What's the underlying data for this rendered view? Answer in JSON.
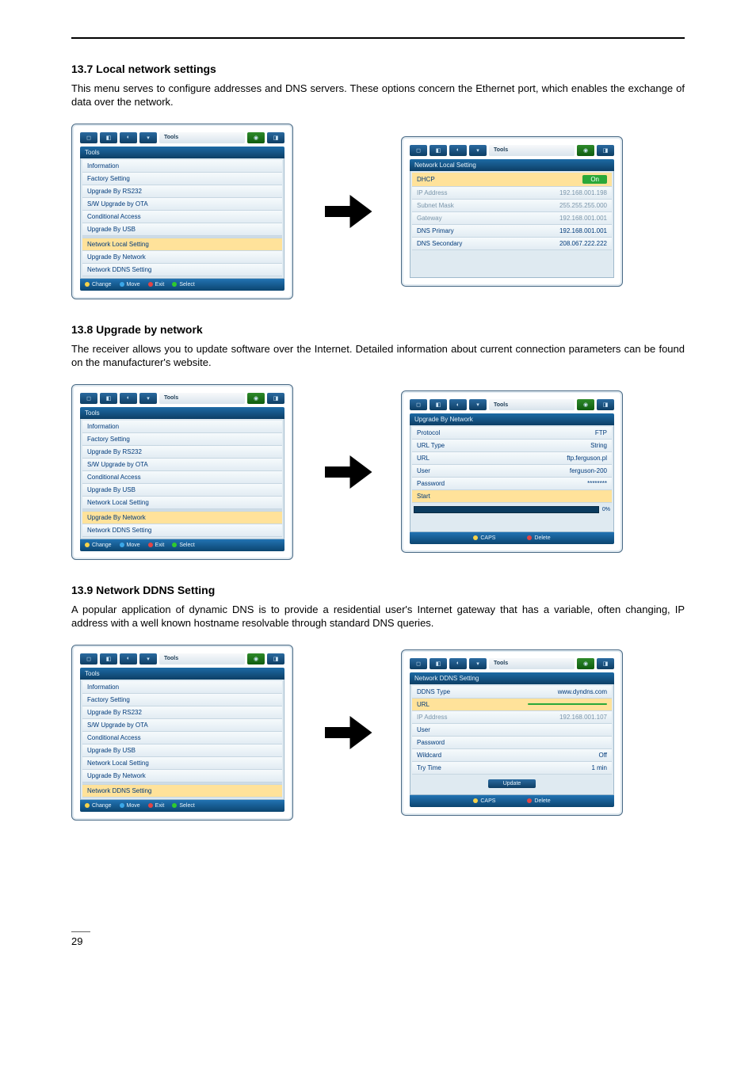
{
  "page_number": "29",
  "sections": {
    "s137": {
      "heading": "13.7 Local network settings",
      "body": "This menu serves to configure addresses and DNS servers. These options concern the Ethernet port, which enables the exchange of data over the network."
    },
    "s138": {
      "heading": "13.8 Upgrade by network",
      "body": "The receiver allows you to update software over the Internet. Detailed information about current connection parameters can be found on the manufacturer's website."
    },
    "s139": {
      "heading": "13.9 Network DDNS Setting",
      "body": "A popular application of dynamic DNS is to provide a residential user's Internet gateway that has a variable, often changing, IP address with a well known hostname resolvable through standard DNS queries."
    }
  },
  "tools_menu": {
    "tab_label": "Tools",
    "title": "Tools",
    "items": [
      "Information",
      "Factory Setting",
      "Upgrade By RS232",
      "S/W Upgrade by OTA",
      "Conditional Access",
      "Upgrade By USB",
      "Network Local Setting",
      "Upgrade By Network",
      "Network DDNS Setting"
    ],
    "footer": {
      "change": "Change",
      "move": "Move",
      "exit": "Exit",
      "select": "Select"
    }
  },
  "network_local": {
    "title": "Network Local Setting",
    "rows": {
      "dhcp": {
        "label": "DHCP",
        "value": "On"
      },
      "ip": {
        "label": "IP Address",
        "value": "192.168.001.198"
      },
      "mask": {
        "label": "Subnet Mask",
        "value": "255.255.255.000"
      },
      "gw": {
        "label": "Gateway",
        "value": "192.168.001.001"
      },
      "dns1": {
        "label": "DNS Primary",
        "value": "192.168.001.001"
      },
      "dns2": {
        "label": "DNS Secondary",
        "value": "208.067.222.222"
      }
    }
  },
  "upgrade_network": {
    "title": "Upgrade By Network",
    "rows": {
      "protocol": {
        "label": "Protocol",
        "value": "FTP"
      },
      "urltype": {
        "label": "URL Type",
        "value": "String"
      },
      "url": {
        "label": "URL",
        "value": "ftp.ferguson.pl"
      },
      "user": {
        "label": "User",
        "value": "ferguson-200"
      },
      "pass": {
        "label": "Password",
        "value": "********"
      },
      "start": {
        "label": "Start",
        "value": ""
      }
    },
    "progress_pct": "0%",
    "footer_caps": "CAPS",
    "footer_delete": "Delete"
  },
  "ddns": {
    "title": "Network DDNS Setting",
    "rows": {
      "type": {
        "label": "DDNS Type",
        "value": "www.dyndns.com"
      },
      "url": {
        "label": "URL",
        "value": ""
      },
      "ip": {
        "label": "IP Address",
        "value": "192.168.001.107"
      },
      "user": {
        "label": "User",
        "value": ""
      },
      "pass": {
        "label": "Password",
        "value": ""
      },
      "wild": {
        "label": "Wildcard",
        "value": "Off"
      },
      "try": {
        "label": "Try Time",
        "value": "1 min"
      }
    },
    "update_btn": "Update",
    "footer_caps": "CAPS",
    "footer_delete": "Delete"
  }
}
